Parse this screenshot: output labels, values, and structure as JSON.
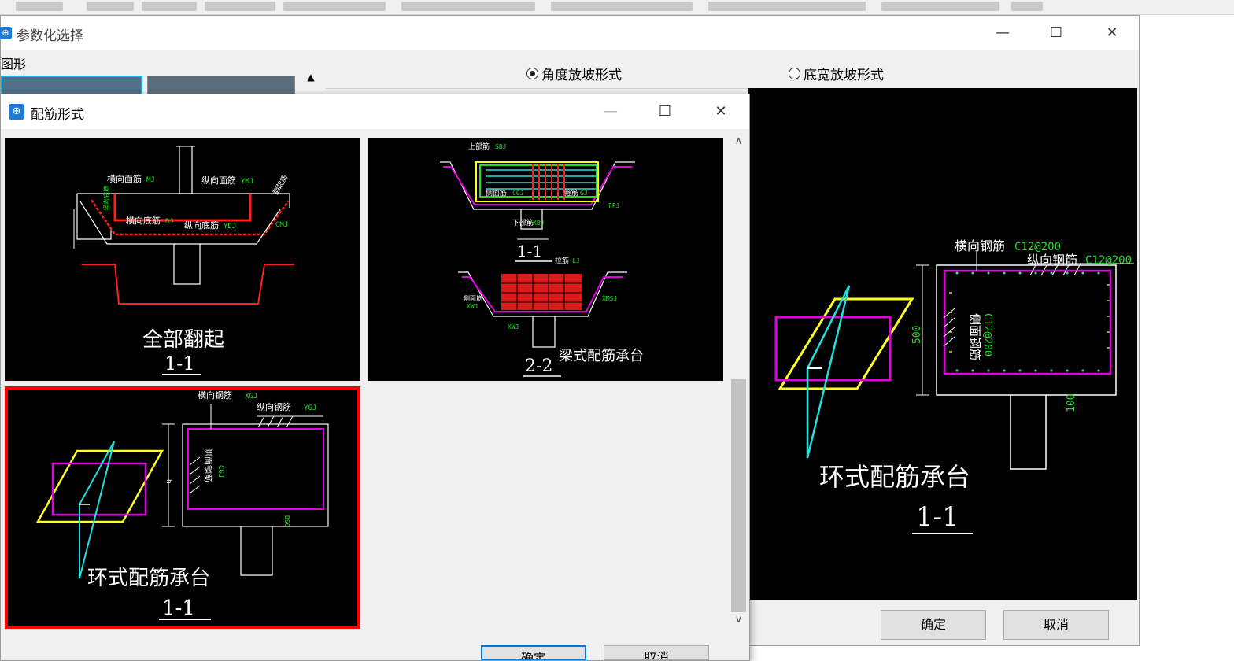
{
  "back_window": {
    "title": "参数化选择",
    "left_group_label": "图形",
    "radio_angle_label": "角度放坡形式",
    "radio_bottom_label": "底宽放坡形式",
    "radio_selected": "angle",
    "preview": {
      "label_transverse": "横向钢筋",
      "value_transverse": "C12@200",
      "label_longitudinal": "纵向钢筋",
      "value_longitudinal": "C12@200",
      "label_side": "侧面钢筋",
      "value_side": "C12@200",
      "dim_height": "500",
      "dim_bottom": "100",
      "caption": "环式配筋承台",
      "section": "1-1"
    },
    "ok_label": "确定",
    "cancel_label": "取消"
  },
  "front_dialog": {
    "title": "配筋形式",
    "items": [
      {
        "caption": "全部翻起",
        "section": "1-1",
        "labels": [
          "横向面筋",
          "MJ",
          "纵向面筋",
          "YMJ",
          "横向底筋",
          "DJ",
          "纵向底筋",
          "YDJ",
          "CMJ",
          "竖向底筋",
          "翻起筋"
        ]
      },
      {
        "caption": "梁式配筋承台",
        "section_top": "1-1",
        "section_bottom": "2-2",
        "labels": [
          "上部筋",
          "SBJ",
          "侧面筋",
          "CGJ",
          "箍筋",
          "GJ",
          "下部筋",
          "XBJ",
          "FPJ",
          "拉筋",
          "LJ",
          "侧面筋",
          "XWJ",
          "XWJ",
          "XMSJ"
        ]
      },
      {
        "caption": "环式配筋承台",
        "section": "1-1",
        "selected": true,
        "labels": [
          "横向钢筋",
          "XGJ",
          "纵向钢筋",
          "YGJ",
          "侧面钢筋",
          "CGJ",
          "h",
          "DSC"
        ]
      }
    ],
    "ok_label": "确定",
    "cancel_label": "取消"
  },
  "colors": {
    "accent_selected": "#ff0000",
    "cad_background": "#000000",
    "rebar_red": "#ff2020",
    "rebar_magenta": "#e000e0",
    "rebar_cyan": "#20e0e0",
    "rebar_yellow": "#ffff20",
    "rebar_green": "#20e020"
  }
}
